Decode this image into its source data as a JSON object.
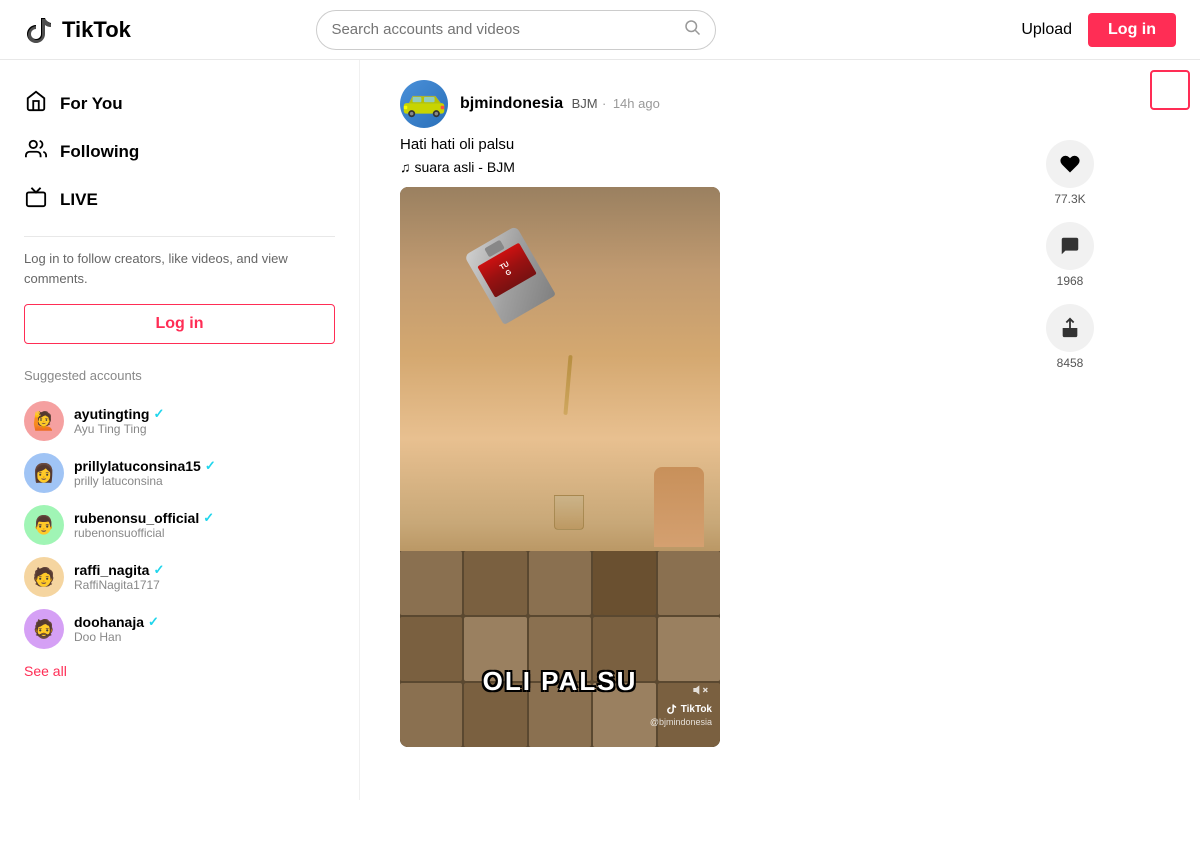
{
  "header": {
    "logo_text": "TikTok",
    "search_placeholder": "Search accounts and videos",
    "upload_label": "Upload",
    "login_label": "Log in"
  },
  "sidebar": {
    "nav_items": [
      {
        "id": "for-you",
        "label": "For You",
        "icon": "🏠"
      },
      {
        "id": "following",
        "label": "Following",
        "icon": "👥"
      },
      {
        "id": "live",
        "label": "LIVE",
        "icon": "📺"
      }
    ],
    "login_prompt": "Log in to follow creators, like videos, and view comments.",
    "login_button_label": "Log in",
    "suggested_title": "Suggested accounts",
    "accounts": [
      {
        "username": "ayutingting",
        "display_name": "Ayu Ting Ting",
        "verified": true,
        "avatar_color": "ayu"
      },
      {
        "username": "prillylatuconsina15",
        "display_name": "prilly latuconsina",
        "verified": true,
        "avatar_color": "prilly"
      },
      {
        "username": "rubenonsu_official",
        "display_name": "rubenonsuofficial",
        "verified": true,
        "avatar_color": "ruben"
      },
      {
        "username": "raffi_nagita",
        "display_name": "RaffiNagita1717",
        "verified": true,
        "avatar_color": "raffi"
      },
      {
        "username": "doohanaja",
        "display_name": "Doo Han",
        "verified": true,
        "avatar_color": "doo"
      }
    ],
    "see_all_label": "See all"
  },
  "video": {
    "poster_username": "bjmindonesia",
    "poster_badge": "BJM",
    "poster_time": "14h ago",
    "caption": "Hati hati oli palsu",
    "music": "suara asli - BJM",
    "overlay_text": "OLI PALSU",
    "watermark_handle": "@bjmindonesia",
    "actions": {
      "likes": "77.3K",
      "comments": "1968",
      "shares": "8458"
    }
  }
}
